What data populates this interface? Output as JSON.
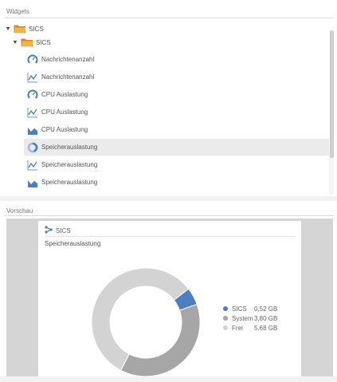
{
  "widgets_panel": {
    "title": "Widgets",
    "tree": {
      "root_label": "SICS",
      "child_label": "SICS"
    },
    "items": [
      {
        "label": "Nachrichtenanzahl",
        "icon": "gauge-icon",
        "selected": false
      },
      {
        "label": "Nachrichtenanzahl",
        "icon": "line-chart-icon",
        "selected": false
      },
      {
        "label": "CPU Auslastung",
        "icon": "gauge-icon",
        "selected": false
      },
      {
        "label": "CPU Auslastung",
        "icon": "line-chart-icon",
        "selected": false
      },
      {
        "label": "CPU Auslastung",
        "icon": "area-chart-icon",
        "selected": false
      },
      {
        "label": "Speicherauslastung",
        "icon": "donut-chart-icon",
        "selected": true
      },
      {
        "label": "Speicherauslastung",
        "icon": "line-chart-icon",
        "selected": false
      },
      {
        "label": "Speicherauslastung",
        "icon": "area-chart-icon",
        "selected": false
      }
    ]
  },
  "preview_panel": {
    "title": "Vorschau",
    "card": {
      "system_label": "SICS",
      "widget_title": "Speicherauslastung"
    }
  },
  "chart_data": {
    "type": "pie",
    "categories": [
      "SICS",
      "System",
      "Frei"
    ],
    "values": [
      0.52,
      3.8,
      5.68
    ],
    "value_labels": [
      "0,52 GB",
      "3,80 GB",
      "5,68 GB"
    ],
    "colors": [
      "#4a7fc1",
      "#a6a6a6",
      "#d3d3d3"
    ],
    "legend_position": "right",
    "donut": true
  },
  "colors": {
    "folder": "#e6a23c",
    "icon_blue": "#4a7fc1",
    "selected_row": "#ebebeb"
  }
}
